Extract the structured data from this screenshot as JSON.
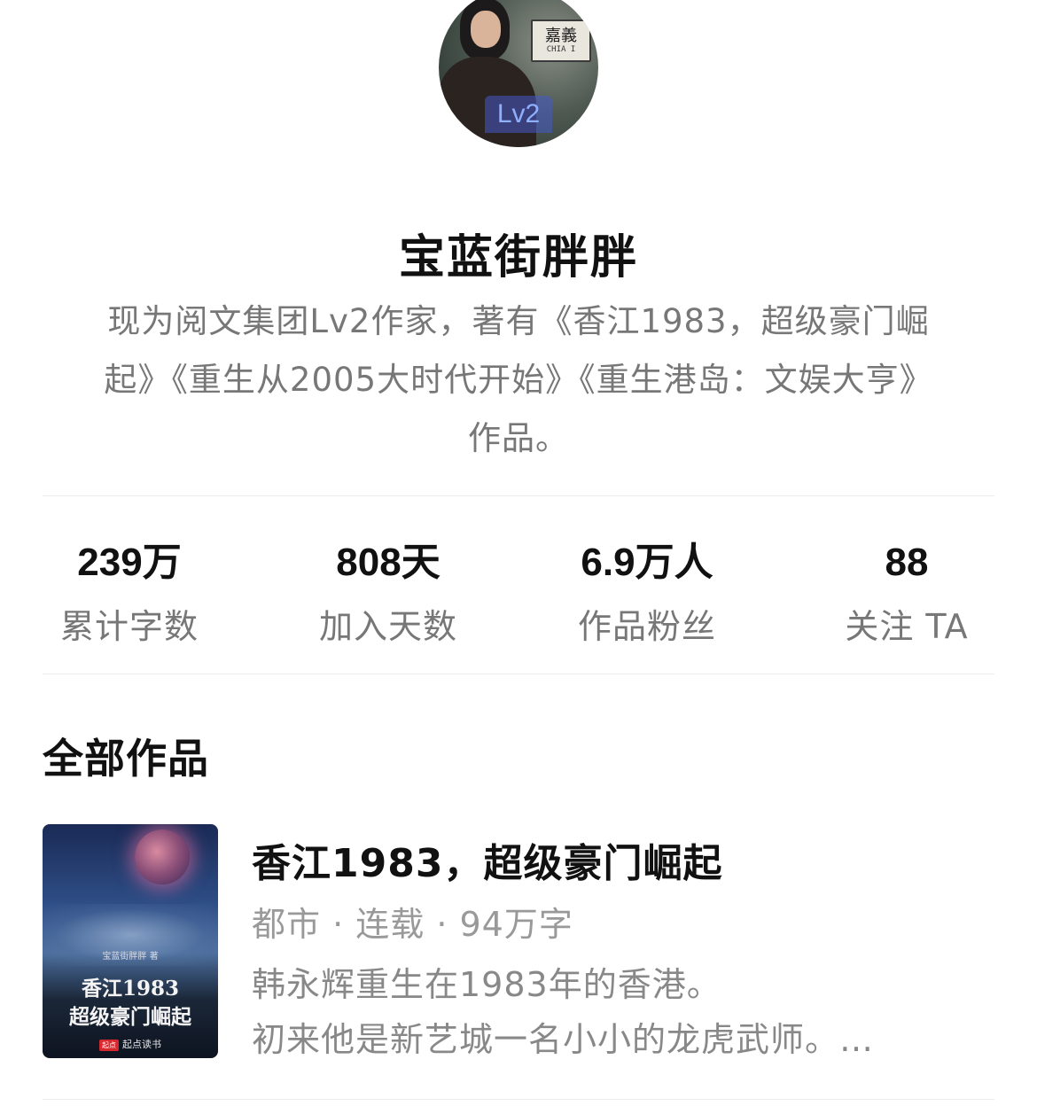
{
  "profile": {
    "level_badge": "Lv2",
    "avatar_sign_text": "嘉義",
    "avatar_sign_subtext": "CHIA I",
    "name": "宝蓝街胖胖",
    "bio_lines": [
      "现为阅文集团Lv2作家，著有《香江1983，超级豪门崛",
      "起》《重生从2005大时代开始》《重生港岛：文娱大亨》",
      "作品。"
    ]
  },
  "stats": [
    {
      "value": "239万",
      "label": "累计字数"
    },
    {
      "value": "808天",
      "label": "加入天数"
    },
    {
      "value": "6.9万人",
      "label": "作品粉丝"
    },
    {
      "value": "88",
      "label": "关注 TA"
    }
  ],
  "works": {
    "section_title": "全部作品",
    "books": [
      {
        "title": "香江1983，超级豪门崛起",
        "meta": "都市 · 连载 · 94万字",
        "desc_lines": [
          "韩永辉重生在1983年的香港。",
          "初来他是新艺城一名小小的龙虎武师。…"
        ],
        "cover": {
          "author": "宝蓝街胖胖 著",
          "title_line1": "香江1983",
          "title_line2": "超级豪门崛起",
          "publisher_logo": "起点",
          "publisher": "起点读书"
        }
      }
    ]
  }
}
